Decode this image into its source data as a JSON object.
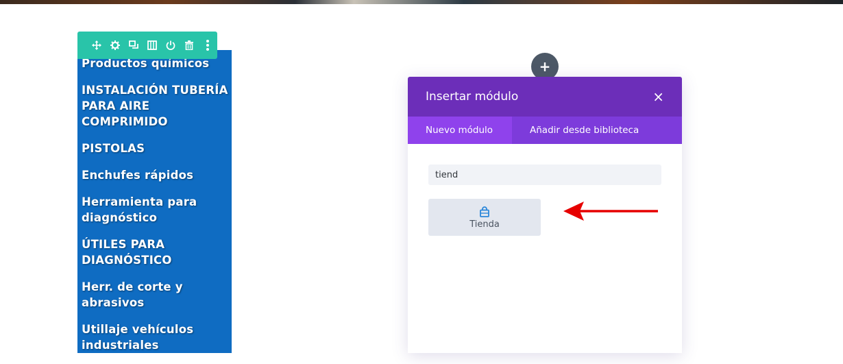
{
  "categories": [
    "Productos químicos",
    "INSTALACIÓN TUBERÍA PARA AIRE COMPRIMIDO",
    "PISTOLAS",
    "Enchufes rápidos",
    "Herramienta para diagnóstico",
    "ÚTILES PARA DIAGNÓSTICO",
    "Herr. de corte y abrasivos",
    "Utillaje vehículos industriales"
  ],
  "toolbar": {
    "icons": [
      "move-icon",
      "gear-icon",
      "duplicate-icon",
      "columns-icon",
      "power-icon",
      "trash-icon",
      "more-icon"
    ],
    "color": "#29c4a9"
  },
  "add_button": {
    "label": "+"
  },
  "modal": {
    "title": "Insertar módulo",
    "close_label": "×",
    "tabs": [
      {
        "label": "Nuevo módulo",
        "active": true
      },
      {
        "label": "Añadir desde biblioteca",
        "active": false
      }
    ],
    "search": {
      "value": "tiend"
    },
    "modules": [
      {
        "label": "Tienda",
        "icon": "shopping-bag-icon"
      }
    ],
    "header_color": "#6c2eb9",
    "tabs_color": "#7d3bdb"
  },
  "colors": {
    "category_bg": "#0f6cc2",
    "annotation_arrow": "#e60000"
  }
}
